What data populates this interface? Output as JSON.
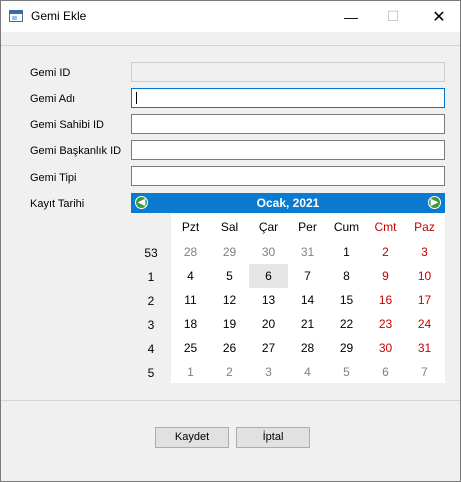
{
  "window": {
    "title": "Gemi Ekle",
    "minimize": "—",
    "maximize": "☐",
    "close": "✕"
  },
  "form": {
    "fields": [
      {
        "label": "Gemi ID",
        "value": ""
      },
      {
        "label": "Gemi Adı",
        "value": ""
      },
      {
        "label": "Gemi Sahibi ID",
        "value": ""
      },
      {
        "label": "Gemi Başkanlık ID",
        "value": ""
      },
      {
        "label": "Gemi Tipi",
        "value": ""
      }
    ],
    "date_label": "Kayıt Tarihi"
  },
  "calendar": {
    "title": "Ocak,  2021",
    "prev": "◀",
    "next": "▶",
    "day_headers": [
      "Pzt",
      "Sal",
      "Çar",
      "Per",
      "Cum",
      "Cmt",
      "Paz"
    ],
    "weeks": [
      {
        "num": "53",
        "days": [
          "28",
          "29",
          "30",
          "31",
          "1",
          "2",
          "3"
        ]
      },
      {
        "num": "1",
        "days": [
          "4",
          "5",
          "6",
          "7",
          "8",
          "9",
          "10"
        ]
      },
      {
        "num": "2",
        "days": [
          "11",
          "12",
          "13",
          "14",
          "15",
          "16",
          "17"
        ]
      },
      {
        "num": "3",
        "days": [
          "18",
          "19",
          "20",
          "21",
          "22",
          "23",
          "24"
        ]
      },
      {
        "num": "4",
        "days": [
          "25",
          "26",
          "27",
          "28",
          "29",
          "30",
          "31"
        ]
      },
      {
        "num": "5",
        "days": [
          "1",
          "2",
          "3",
          "4",
          "5",
          "6",
          "7"
        ]
      }
    ],
    "selected_day": "6",
    "weekend_color": "#c80000",
    "header_color": "#0a7bd0"
  },
  "buttons": {
    "save": "Kaydet",
    "cancel": "İptal"
  }
}
